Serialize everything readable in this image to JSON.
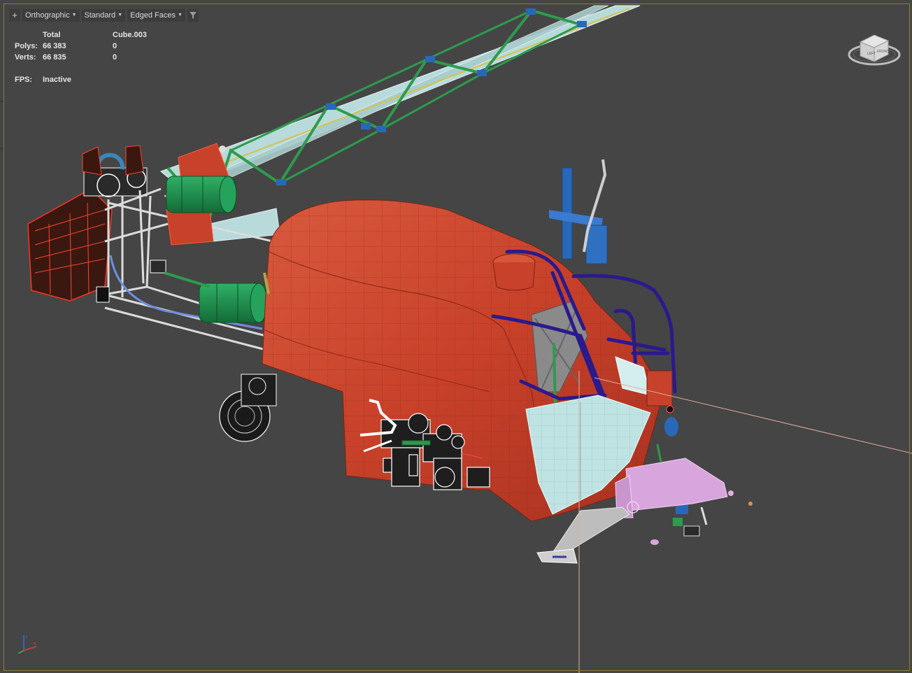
{
  "viewport": {
    "toolbar": {
      "plus_label": "+",
      "view_label": "Orthographic",
      "shading_label": "Standard",
      "display_label": "Edged Faces",
      "dropdown_icon": "triangle-down-icon",
      "filter_icon": "funnel-icon"
    },
    "stats": {
      "col_total": "Total",
      "col_object": "Cube.003",
      "polys_label": "Polys:",
      "polys_total": "66 383",
      "polys_object": "0",
      "verts_label": "Verts:",
      "verts_total": "66 835",
      "verts_object": "0",
      "fps_label": "FPS:",
      "fps_value": "Inactive"
    },
    "viewcube": {
      "left_face": "LEFT",
      "front_face": "FRONT"
    },
    "colors": {
      "background": "#454545",
      "border": "#8c7d3b",
      "body_red": "#c8412a",
      "frame_green": "#2e9a4e",
      "roll_cage": "#2a1a8c",
      "glass": "#bfe3e3",
      "boom": "#b8dada",
      "tank_green": "#1b8a4a",
      "hitch_pink": "#d8a6dc"
    }
  }
}
